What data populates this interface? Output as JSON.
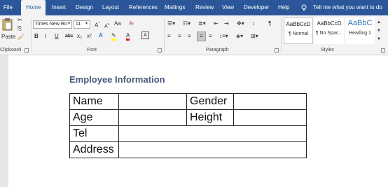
{
  "menu": {
    "tabs": [
      "File",
      "Home",
      "Insert",
      "Design",
      "Layout",
      "References",
      "Mailings",
      "Review",
      "View",
      "Developer",
      "Help"
    ],
    "active_tab": "Home",
    "tell_me": "Tell me what you want to do"
  },
  "ribbon": {
    "clipboard": {
      "paste_label": "Paste",
      "group_label": "Clipboard"
    },
    "font": {
      "font_name": "Times New Ro",
      "font_size": "11",
      "grow_label": "A",
      "shrink_label": "A",
      "case_label": "Aa",
      "bold": "B",
      "italic": "I",
      "underline": "U",
      "strikethrough": "abc",
      "subscript": "x₂",
      "superscript": "x²",
      "font_color_label": "A",
      "group_label": "Font"
    },
    "paragraph": {
      "pilcrow": "¶",
      "group_label": "Paragraph"
    },
    "styles": {
      "items": [
        {
          "sample": "AaBbCcD",
          "name": "¶ Normal"
        },
        {
          "sample": "AaBbCcD",
          "name": "¶ No Spac..."
        },
        {
          "sample": "AaBbC",
          "name": "Heading 1"
        }
      ],
      "group_label": "Styles"
    }
  },
  "document": {
    "heading": "Employee Information",
    "table": {
      "rows": [
        [
          "Name",
          "",
          "Gender",
          ""
        ],
        [
          "Age",
          "",
          "Height",
          ""
        ],
        [
          "Tel",
          ""
        ],
        [
          "Address",
          ""
        ]
      ]
    }
  },
  "colors": {
    "title_bar": "#2b579a",
    "heading": "#465a78",
    "heading_style_sample": "#2e74b5"
  }
}
